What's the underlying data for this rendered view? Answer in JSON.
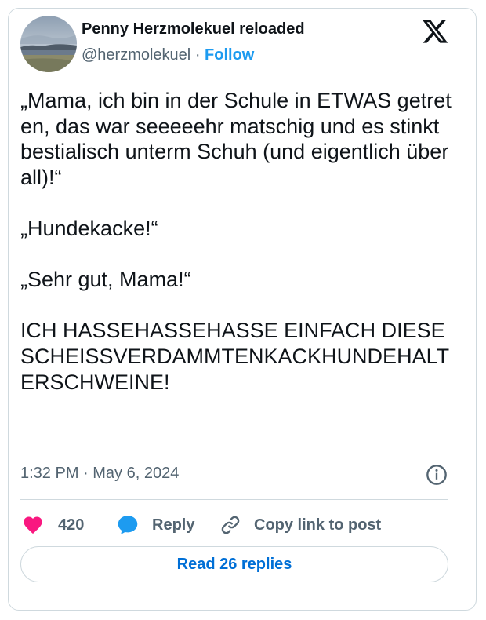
{
  "tweet": {
    "author_name": "Penny Herzmolekuel reloaded",
    "handle": "@herzmolekuel",
    "separator": "·",
    "follow_label": "Follow",
    "text": "„Mama, ich bin in der Schule in ETWAS getreten, das war seeeeehr matschig und es stinkt bestialisch unterm Schuh (und eigentlich überall)!“\n\n„Hundekacke!“\n\n„Sehr gut, Mama!“\n\nICH HASSEHASSEHASSE EINFACH DIESE SCHEISSVERDAMMTENKACKHUNDEHALTERSCHWEINE!",
    "timestamp": "1:32 PM · May 6, 2024"
  },
  "actions": {
    "like_count": "420",
    "reply_label": "Reply",
    "copy_label": "Copy link to post",
    "read_replies_label": "Read 26 replies"
  },
  "icons": {
    "platform_logo": "x-logo-icon",
    "info": "info-icon",
    "like": "heart-icon",
    "reply": "speech-bubble-icon",
    "copy": "link-icon"
  },
  "colors": {
    "accent": "#1d9bf0",
    "like": "#f91880",
    "text": "#0f1419",
    "secondary": "#536471",
    "border": "#cfd9de"
  }
}
